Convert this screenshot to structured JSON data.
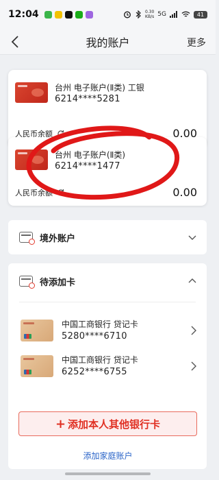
{
  "status_bar": {
    "time": "12:04",
    "net_speed_value": "0.30",
    "net_speed_unit": "KB/s",
    "network": "5G",
    "battery": "41"
  },
  "nav": {
    "title": "我的账户",
    "more": "更多"
  },
  "accounts": [
    {
      "name": "台州 电子账户(Ⅱ类) 工银",
      "number": "6214****5281",
      "balance_label": "人民币余额",
      "balance": "0.00"
    },
    {
      "name": "台州 电子账户(Ⅱ类)",
      "number": "6214****1477",
      "balance_label": "人民币余额",
      "balance": "0.00"
    }
  ],
  "overseas": {
    "title": "境外账户"
  },
  "pending": {
    "title": "待添加卡",
    "cards": [
      {
        "name": "中国工商银行 贷记卡",
        "number": "5280****6710"
      },
      {
        "name": "中国工商银行 贷记卡",
        "number": "6252****6755"
      }
    ]
  },
  "actions": {
    "add_plus": "+",
    "add_label": "添加本人其他银行卡",
    "family_link": "添加家庭账户"
  },
  "colors": {
    "accent_red": "#e02f22",
    "link_blue": "#2a64c8",
    "annotation_red": "#e01818"
  },
  "icons": [
    "back-arrow-icon",
    "refresh-icon",
    "chevron-down-icon",
    "chevron-up-icon",
    "chevron-right-icon",
    "card-icon"
  ]
}
